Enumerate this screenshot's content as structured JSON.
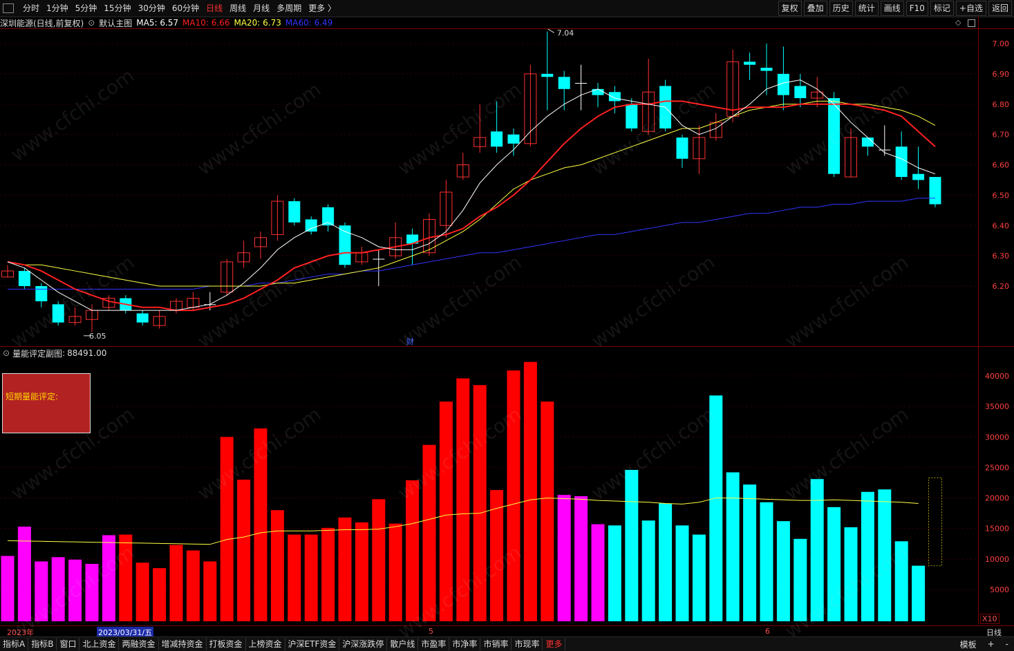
{
  "toolbar": {
    "periods": [
      "分时",
      "1分钟",
      "5分钟",
      "15分钟",
      "30分钟",
      "60分钟",
      "日线",
      "周线",
      "月线",
      "多周期",
      "更多 〉"
    ],
    "active_period": "日线",
    "tools": [
      "复权",
      "叠加",
      "历史",
      "统计",
      "画线",
      "F10",
      "标记",
      "+自选",
      "返回"
    ]
  },
  "main_header": {
    "title": "深圳能源(日线,前复权)",
    "indicator": "默认主图",
    "ma5": "MA5: 6.57",
    "ma10": "MA10: 6.66",
    "ma20": "MA20: 6.73",
    "ma60": "MA60: 6.49",
    "colors": {
      "ma5": "#ffffff",
      "ma10": "#ff2020",
      "ma20": "#ffff40",
      "ma60": "#3333ff"
    }
  },
  "price_axis": [
    "7.00",
    "6.90",
    "6.80",
    "6.70",
    "6.60",
    "6.50",
    "6.40",
    "6.30",
    "6.20"
  ],
  "volume_axis": [
    "40000",
    "35000",
    "30000",
    "25000",
    "20000",
    "15000",
    "10000",
    "5000"
  ],
  "annotations": {
    "high": "7.04",
    "low": "6.05",
    "finance_mark": "财"
  },
  "sub_header": {
    "title": "量能评定副图",
    "value": "88491.00"
  },
  "eval_box": {
    "label": "短期量能评定:"
  },
  "x10": "X10",
  "date_axis": {
    "year": "2023年",
    "cursor_date": "2023/03/31/五",
    "month5": "5",
    "month6": "6",
    "period": "日线"
  },
  "bottom_tabs": [
    "指标A",
    "指标B",
    "窗口",
    "北上资金",
    "两融资金",
    "增减持资金",
    "打板资金",
    "上榜资金",
    "沪深ETF资金",
    "沪深涨跌停",
    "散户线",
    "市盈率",
    "市净率",
    "市销率",
    "市现率",
    "更多"
  ],
  "bottom_right": [
    "模板",
    "+",
    "-"
  ],
  "watermark": "www.cfchi.com",
  "chart_data": {
    "type": "candlestick",
    "candles": [
      {
        "o": 6.23,
        "c": 6.25,
        "h": 6.27,
        "l": 6.23
      },
      {
        "o": 6.25,
        "c": 6.2,
        "h": 6.26,
        "l": 6.19
      },
      {
        "o": 6.2,
        "c": 6.15,
        "h": 6.21,
        "l": 6.13
      },
      {
        "o": 6.14,
        "c": 6.08,
        "h": 6.15,
        "l": 6.07
      },
      {
        "o": 6.08,
        "c": 6.1,
        "h": 6.13,
        "l": 6.07
      },
      {
        "o": 6.09,
        "c": 6.12,
        "h": 6.14,
        "l": 6.05
      },
      {
        "o": 6.13,
        "c": 6.16,
        "h": 6.17,
        "l": 6.12
      },
      {
        "o": 6.16,
        "c": 6.12,
        "h": 6.17,
        "l": 6.11
      },
      {
        "o": 6.11,
        "c": 6.08,
        "h": 6.12,
        "l": 6.07
      },
      {
        "o": 6.07,
        "c": 6.1,
        "h": 6.12,
        "l": 6.06
      },
      {
        "o": 6.12,
        "c": 6.15,
        "h": 6.16,
        "l": 6.11
      },
      {
        "o": 6.13,
        "c": 6.16,
        "h": 6.18,
        "l": 6.12
      },
      {
        "o": 6.14,
        "c": 6.14,
        "h": 6.18,
        "l": 6.12
      },
      {
        "o": 6.18,
        "c": 6.28,
        "h": 6.29,
        "l": 6.17
      },
      {
        "o": 6.28,
        "c": 6.31,
        "h": 6.35,
        "l": 6.26
      },
      {
        "o": 6.33,
        "c": 6.36,
        "h": 6.38,
        "l": 6.29
      },
      {
        "o": 6.37,
        "c": 6.48,
        "h": 6.5,
        "l": 6.35
      },
      {
        "o": 6.48,
        "c": 6.41,
        "h": 6.49,
        "l": 6.4
      },
      {
        "o": 6.42,
        "c": 6.38,
        "h": 6.43,
        "l": 6.37
      },
      {
        "o": 6.46,
        "c": 6.4,
        "h": 6.47,
        "l": 6.38
      },
      {
        "o": 6.4,
        "c": 6.27,
        "h": 6.41,
        "l": 6.26
      },
      {
        "o": 6.28,
        "c": 6.31,
        "h": 6.33,
        "l": 6.27
      },
      {
        "o": 6.29,
        "c": 6.29,
        "h": 6.32,
        "l": 6.2
      },
      {
        "o": 6.3,
        "c": 6.36,
        "h": 6.41,
        "l": 6.29
      },
      {
        "o": 6.37,
        "c": 6.34,
        "h": 6.39,
        "l": 6.27
      },
      {
        "o": 6.31,
        "c": 6.42,
        "h": 6.44,
        "l": 6.3
      },
      {
        "o": 6.4,
        "c": 6.51,
        "h": 6.55,
        "l": 6.36
      },
      {
        "o": 6.56,
        "c": 6.6,
        "h": 6.64,
        "l": 6.55
      },
      {
        "o": 6.66,
        "c": 6.69,
        "h": 6.8,
        "l": 6.64
      },
      {
        "o": 6.71,
        "c": 6.66,
        "h": 6.81,
        "l": 6.64
      },
      {
        "o": 6.7,
        "c": 6.67,
        "h": 6.72,
        "l": 6.63
      },
      {
        "o": 6.67,
        "c": 6.9,
        "h": 6.93,
        "l": 6.66
      },
      {
        "o": 6.9,
        "c": 6.89,
        "h": 7.04,
        "l": 6.78
      },
      {
        "o": 6.89,
        "c": 6.85,
        "h": 6.91,
        "l": 6.78
      },
      {
        "o": 6.87,
        "c": 6.87,
        "h": 6.93,
        "l": 6.78
      },
      {
        "o": 6.85,
        "c": 6.83,
        "h": 6.87,
        "l": 6.79
      },
      {
        "o": 6.84,
        "c": 6.81,
        "h": 6.86,
        "l": 6.77
      },
      {
        "o": 6.8,
        "c": 6.72,
        "h": 6.82,
        "l": 6.71
      },
      {
        "o": 6.71,
        "c": 6.84,
        "h": 6.95,
        "l": 6.7
      },
      {
        "o": 6.86,
        "c": 6.72,
        "h": 6.88,
        "l": 6.71
      },
      {
        "o": 6.69,
        "c": 6.62,
        "h": 6.7,
        "l": 6.59
      },
      {
        "o": 6.62,
        "c": 6.69,
        "h": 6.73,
        "l": 6.57
      },
      {
        "o": 6.69,
        "c": 6.74,
        "h": 6.77,
        "l": 6.68
      },
      {
        "o": 6.76,
        "c": 6.94,
        "h": 6.98,
        "l": 6.74
      },
      {
        "o": 6.94,
        "c": 6.93,
        "h": 6.97,
        "l": 6.88
      },
      {
        "o": 6.92,
        "c": 6.91,
        "h": 7.0,
        "l": 6.83
      },
      {
        "o": 6.9,
        "c": 6.83,
        "h": 6.99,
        "l": 6.78
      },
      {
        "o": 6.86,
        "c": 6.82,
        "h": 6.9,
        "l": 6.79
      },
      {
        "o": 6.82,
        "c": 6.84,
        "h": 6.89,
        "l": 6.79
      },
      {
        "o": 6.82,
        "c": 6.57,
        "h": 6.84,
        "l": 6.56
      },
      {
        "o": 6.56,
        "c": 6.69,
        "h": 6.72,
        "l": 6.56
      },
      {
        "o": 6.69,
        "c": 6.66,
        "h": 6.69,
        "l": 6.63
      },
      {
        "o": 6.65,
        "c": 6.65,
        "h": 6.73,
        "l": 6.63
      },
      {
        "o": 6.66,
        "c": 6.56,
        "h": 6.71,
        "l": 6.55
      },
      {
        "o": 6.57,
        "c": 6.55,
        "h": 6.66,
        "l": 6.52
      },
      {
        "o": 6.56,
        "c": 6.47,
        "h": 6.56,
        "l": 6.46
      }
    ],
    "ma5": [
      6.28,
      6.26,
      6.22,
      6.18,
      6.15,
      6.12,
      6.12,
      6.12,
      6.12,
      6.12,
      6.12,
      6.13,
      6.14,
      6.17,
      6.21,
      6.26,
      6.32,
      6.36,
      6.39,
      6.41,
      6.38,
      6.36,
      6.33,
      6.32,
      6.32,
      6.34,
      6.38,
      6.45,
      6.54,
      6.6,
      6.65,
      6.71,
      6.76,
      6.8,
      6.83,
      6.85,
      6.82,
      6.81,
      6.8,
      6.79,
      6.73,
      6.7,
      6.72,
      6.76,
      6.8,
      6.85,
      6.87,
      6.88,
      6.85,
      6.8,
      6.74,
      6.69,
      6.64,
      6.62,
      6.59,
      6.57
    ],
    "ma10": [
      6.28,
      6.27,
      6.25,
      6.22,
      6.19,
      6.17,
      6.15,
      6.14,
      6.13,
      6.13,
      6.12,
      6.12,
      6.13,
      6.14,
      6.16,
      6.19,
      6.22,
      6.26,
      6.28,
      6.3,
      6.31,
      6.31,
      6.32,
      6.33,
      6.34,
      6.36,
      6.37,
      6.39,
      6.43,
      6.46,
      6.5,
      6.55,
      6.61,
      6.67,
      6.72,
      6.76,
      6.79,
      6.8,
      6.8,
      6.81,
      6.81,
      6.8,
      6.79,
      6.78,
      6.79,
      6.79,
      6.79,
      6.8,
      6.8,
      6.8,
      6.8,
      6.79,
      6.78,
      6.76,
      6.71,
      6.66
    ],
    "ma20": [
      6.28,
      6.27,
      6.27,
      6.26,
      6.25,
      6.24,
      6.23,
      6.22,
      6.21,
      6.2,
      6.2,
      6.2,
      6.2,
      6.2,
      6.2,
      6.2,
      6.21,
      6.21,
      6.22,
      6.23,
      6.24,
      6.25,
      6.26,
      6.28,
      6.3,
      6.32,
      6.35,
      6.38,
      6.42,
      6.47,
      6.52,
      6.55,
      6.57,
      6.59,
      6.6,
      6.62,
      6.64,
      6.66,
      6.68,
      6.7,
      6.72,
      6.72,
      6.74,
      6.76,
      6.78,
      6.79,
      6.8,
      6.8,
      6.81,
      6.81,
      6.8,
      6.8,
      6.79,
      6.78,
      6.76,
      6.73
    ],
    "ma60": [
      6.19,
      6.19,
      6.19,
      6.19,
      6.19,
      6.19,
      6.19,
      6.19,
      6.19,
      6.19,
      6.19,
      6.19,
      6.2,
      6.2,
      6.2,
      6.21,
      6.21,
      6.22,
      6.23,
      6.24,
      6.24,
      6.25,
      6.25,
      6.26,
      6.27,
      6.28,
      6.29,
      6.3,
      6.31,
      6.31,
      6.32,
      6.33,
      6.34,
      6.35,
      6.36,
      6.37,
      6.37,
      6.38,
      6.39,
      6.4,
      6.41,
      6.41,
      6.42,
      6.43,
      6.44,
      6.44,
      6.45,
      6.46,
      6.46,
      6.47,
      6.47,
      6.48,
      6.48,
      6.48,
      6.49,
      6.49
    ],
    "volumes": [
      10500,
      15300,
      9600,
      10300,
      9900,
      9200,
      13900,
      14000,
      9400,
      8500,
      12300,
      11400,
      9600,
      30000,
      23000,
      31400,
      18000,
      14000,
      14000,
      15100,
      16800,
      16000,
      19800,
      15800,
      22900,
      28700,
      35800,
      39600,
      38500,
      21300,
      40900,
      42300,
      35800,
      20500,
      20300,
      15700,
      15500,
      24600,
      16300,
      19100,
      15500,
      14000,
      36800,
      24200,
      22200,
      19300,
      16200,
      13300,
      23100,
      18500,
      15200,
      21000,
      21400,
      12900,
      8900
    ],
    "volume_colors": [
      "m",
      "m",
      "m",
      "m",
      "m",
      "m",
      "m",
      "r",
      "r",
      "r",
      "r",
      "r",
      "r",
      "r",
      "r",
      "r",
      "r",
      "r",
      "r",
      "r",
      "r",
      "r",
      "r",
      "r",
      "r",
      "r",
      "r",
      "r",
      "r",
      "r",
      "r",
      "r",
      "r",
      "m",
      "m",
      "m",
      "c",
      "c",
      "c",
      "c",
      "c",
      "c",
      "c",
      "c",
      "c",
      "c",
      "c",
      "c",
      "c",
      "c",
      "c",
      "c",
      "c",
      "c",
      "c"
    ],
    "volume_ma": [
      13000,
      12950,
      12900,
      12850,
      12800,
      12750,
      12700,
      12650,
      12600,
      12550,
      12500,
      12450,
      12400,
      13200,
      13600,
      14300,
      14600,
      14600,
      14600,
      14700,
      14800,
      14800,
      14900,
      15300,
      15800,
      16500,
      17200,
      17400,
      17500,
      18300,
      19000,
      19700,
      20000,
      19900,
      19800,
      19600,
      19500,
      19400,
      19300,
      19100,
      19000,
      19300,
      20000,
      20000,
      19900,
      19800,
      19700,
      19600,
      19600,
      19700,
      19600,
      19500,
      19400,
      19300,
      19100
    ]
  }
}
